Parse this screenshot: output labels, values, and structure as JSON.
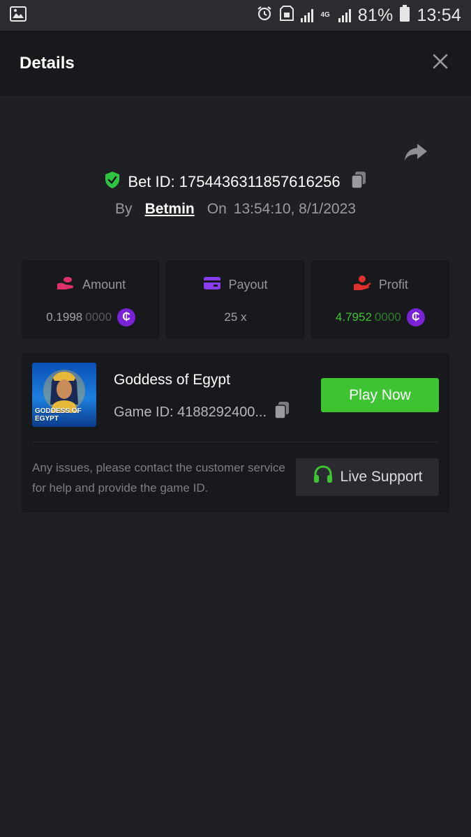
{
  "status_bar": {
    "battery": "81%",
    "time": "13:54",
    "network": "4G"
  },
  "header": {
    "title": "Details"
  },
  "bet": {
    "id_label": "Bet ID: 1754436311857616256",
    "by_label": "By",
    "user": "Betmin",
    "on_label": "On",
    "datetime": "13:54:10, 8/1/2023"
  },
  "stats": {
    "amount": {
      "label": "Amount",
      "value_main": "0.1998",
      "value_dim": "0000"
    },
    "payout": {
      "label": "Payout",
      "value": "25 x"
    },
    "profit": {
      "label": "Profit",
      "value_main": "4.7952",
      "value_dim": "0000"
    }
  },
  "coin_symbol": "₵",
  "game": {
    "thumb_text": "GODDESS OF EGYPT",
    "name": "Goddess of Egypt",
    "id_label": "Game ID: 4188292400...",
    "play_label": "Play Now",
    "help_text": "Any issues, please contact the customer service for help and provide the game ID.",
    "support_label": "Live Support"
  },
  "colors": {
    "accent_green": "#3ec332",
    "coin_purple": "#7a22d6",
    "amount_icon": "#e0306a",
    "payout_icon": "#8a3cf0",
    "profit_icon": "#e0302d",
    "shield_green": "#2ec640"
  },
  "icons": {
    "close": "close-icon",
    "share": "share-icon",
    "shield": "shield-check-icon",
    "copy": "copy-icon",
    "amount": "coins-hand-icon",
    "payout": "wallet-card-icon",
    "profit": "hand-money-icon",
    "headset": "headset-icon"
  }
}
